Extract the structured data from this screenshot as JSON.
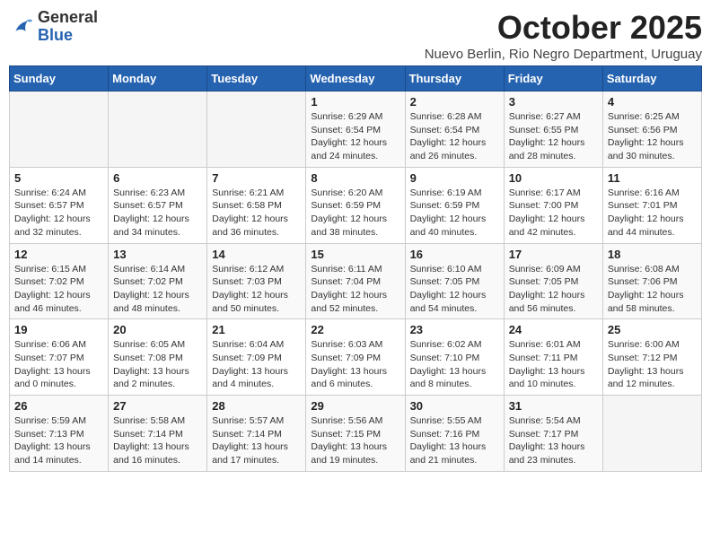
{
  "header": {
    "logo_general": "General",
    "logo_blue": "Blue",
    "month": "October 2025",
    "location": "Nuevo Berlin, Rio Negro Department, Uruguay"
  },
  "weekdays": [
    "Sunday",
    "Monday",
    "Tuesday",
    "Wednesday",
    "Thursday",
    "Friday",
    "Saturday"
  ],
  "weeks": [
    [
      {
        "day": "",
        "info": ""
      },
      {
        "day": "",
        "info": ""
      },
      {
        "day": "",
        "info": ""
      },
      {
        "day": "1",
        "info": "Sunrise: 6:29 AM\nSunset: 6:54 PM\nDaylight: 12 hours\nand 24 minutes."
      },
      {
        "day": "2",
        "info": "Sunrise: 6:28 AM\nSunset: 6:54 PM\nDaylight: 12 hours\nand 26 minutes."
      },
      {
        "day": "3",
        "info": "Sunrise: 6:27 AM\nSunset: 6:55 PM\nDaylight: 12 hours\nand 28 minutes."
      },
      {
        "day": "4",
        "info": "Sunrise: 6:25 AM\nSunset: 6:56 PM\nDaylight: 12 hours\nand 30 minutes."
      }
    ],
    [
      {
        "day": "5",
        "info": "Sunrise: 6:24 AM\nSunset: 6:57 PM\nDaylight: 12 hours\nand 32 minutes."
      },
      {
        "day": "6",
        "info": "Sunrise: 6:23 AM\nSunset: 6:57 PM\nDaylight: 12 hours\nand 34 minutes."
      },
      {
        "day": "7",
        "info": "Sunrise: 6:21 AM\nSunset: 6:58 PM\nDaylight: 12 hours\nand 36 minutes."
      },
      {
        "day": "8",
        "info": "Sunrise: 6:20 AM\nSunset: 6:59 PM\nDaylight: 12 hours\nand 38 minutes."
      },
      {
        "day": "9",
        "info": "Sunrise: 6:19 AM\nSunset: 6:59 PM\nDaylight: 12 hours\nand 40 minutes."
      },
      {
        "day": "10",
        "info": "Sunrise: 6:17 AM\nSunset: 7:00 PM\nDaylight: 12 hours\nand 42 minutes."
      },
      {
        "day": "11",
        "info": "Sunrise: 6:16 AM\nSunset: 7:01 PM\nDaylight: 12 hours\nand 44 minutes."
      }
    ],
    [
      {
        "day": "12",
        "info": "Sunrise: 6:15 AM\nSunset: 7:02 PM\nDaylight: 12 hours\nand 46 minutes."
      },
      {
        "day": "13",
        "info": "Sunrise: 6:14 AM\nSunset: 7:02 PM\nDaylight: 12 hours\nand 48 minutes."
      },
      {
        "day": "14",
        "info": "Sunrise: 6:12 AM\nSunset: 7:03 PM\nDaylight: 12 hours\nand 50 minutes."
      },
      {
        "day": "15",
        "info": "Sunrise: 6:11 AM\nSunset: 7:04 PM\nDaylight: 12 hours\nand 52 minutes."
      },
      {
        "day": "16",
        "info": "Sunrise: 6:10 AM\nSunset: 7:05 PM\nDaylight: 12 hours\nand 54 minutes."
      },
      {
        "day": "17",
        "info": "Sunrise: 6:09 AM\nSunset: 7:05 PM\nDaylight: 12 hours\nand 56 minutes."
      },
      {
        "day": "18",
        "info": "Sunrise: 6:08 AM\nSunset: 7:06 PM\nDaylight: 12 hours\nand 58 minutes."
      }
    ],
    [
      {
        "day": "19",
        "info": "Sunrise: 6:06 AM\nSunset: 7:07 PM\nDaylight: 13 hours\nand 0 minutes."
      },
      {
        "day": "20",
        "info": "Sunrise: 6:05 AM\nSunset: 7:08 PM\nDaylight: 13 hours\nand 2 minutes."
      },
      {
        "day": "21",
        "info": "Sunrise: 6:04 AM\nSunset: 7:09 PM\nDaylight: 13 hours\nand 4 minutes."
      },
      {
        "day": "22",
        "info": "Sunrise: 6:03 AM\nSunset: 7:09 PM\nDaylight: 13 hours\nand 6 minutes."
      },
      {
        "day": "23",
        "info": "Sunrise: 6:02 AM\nSunset: 7:10 PM\nDaylight: 13 hours\nand 8 minutes."
      },
      {
        "day": "24",
        "info": "Sunrise: 6:01 AM\nSunset: 7:11 PM\nDaylight: 13 hours\nand 10 minutes."
      },
      {
        "day": "25",
        "info": "Sunrise: 6:00 AM\nSunset: 7:12 PM\nDaylight: 13 hours\nand 12 minutes."
      }
    ],
    [
      {
        "day": "26",
        "info": "Sunrise: 5:59 AM\nSunset: 7:13 PM\nDaylight: 13 hours\nand 14 minutes."
      },
      {
        "day": "27",
        "info": "Sunrise: 5:58 AM\nSunset: 7:14 PM\nDaylight: 13 hours\nand 16 minutes."
      },
      {
        "day": "28",
        "info": "Sunrise: 5:57 AM\nSunset: 7:14 PM\nDaylight: 13 hours\nand 17 minutes."
      },
      {
        "day": "29",
        "info": "Sunrise: 5:56 AM\nSunset: 7:15 PM\nDaylight: 13 hours\nand 19 minutes."
      },
      {
        "day": "30",
        "info": "Sunrise: 5:55 AM\nSunset: 7:16 PM\nDaylight: 13 hours\nand 21 minutes."
      },
      {
        "day": "31",
        "info": "Sunrise: 5:54 AM\nSunset: 7:17 PM\nDaylight: 13 hours\nand 23 minutes."
      },
      {
        "day": "",
        "info": ""
      }
    ]
  ]
}
